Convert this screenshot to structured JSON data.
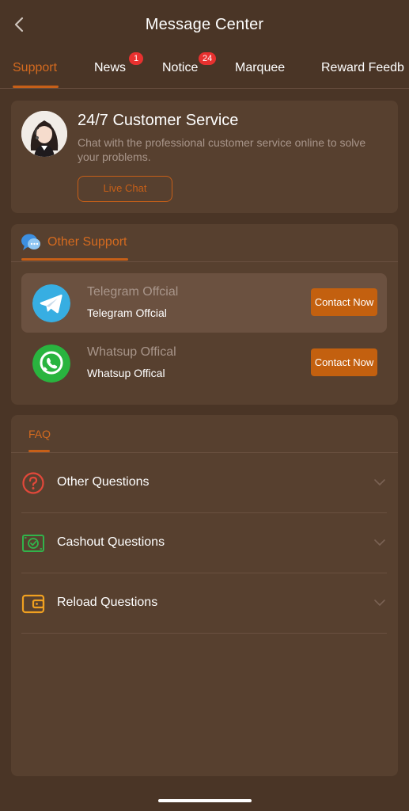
{
  "header": {
    "title": "Message Center",
    "back_icon": "chevron-left-icon"
  },
  "tabs": [
    {
      "label": "Support",
      "active": true,
      "badge": ""
    },
    {
      "label": "News",
      "active": false,
      "badge": "1"
    },
    {
      "label": "Notice",
      "active": false,
      "badge": "24"
    },
    {
      "label": "Marquee",
      "active": false,
      "badge": ""
    },
    {
      "label": "Reward Feedb",
      "active": false,
      "badge": ""
    }
  ],
  "customer_service": {
    "title": "24/7 Customer Service",
    "description": "Chat with the professional customer service online to solve your problems.",
    "button_label": "Live Chat"
  },
  "other_support": {
    "heading": "Other Support",
    "items": [
      {
        "name": "Telegram Offcial",
        "sub": "Telegram Offcial",
        "button_label": "Contact Now",
        "icon": "telegram-icon"
      },
      {
        "name": "Whatsup Offical",
        "sub": "Whatsup Offical",
        "button_label": "Contact Now",
        "icon": "whatsapp-icon"
      }
    ]
  },
  "faq": {
    "tab_label": "FAQ",
    "items": [
      {
        "label": "Other Questions",
        "icon": "question-circle-icon"
      },
      {
        "label": "Cashout Questions",
        "icon": "cash-icon"
      },
      {
        "label": "Reload Questions",
        "icon": "wallet-icon"
      }
    ]
  },
  "colors": {
    "background": "#4a3526",
    "card": "#57402f",
    "accent": "#c65f18",
    "badge": "#e8312f",
    "muted_text": "#a8958a"
  }
}
